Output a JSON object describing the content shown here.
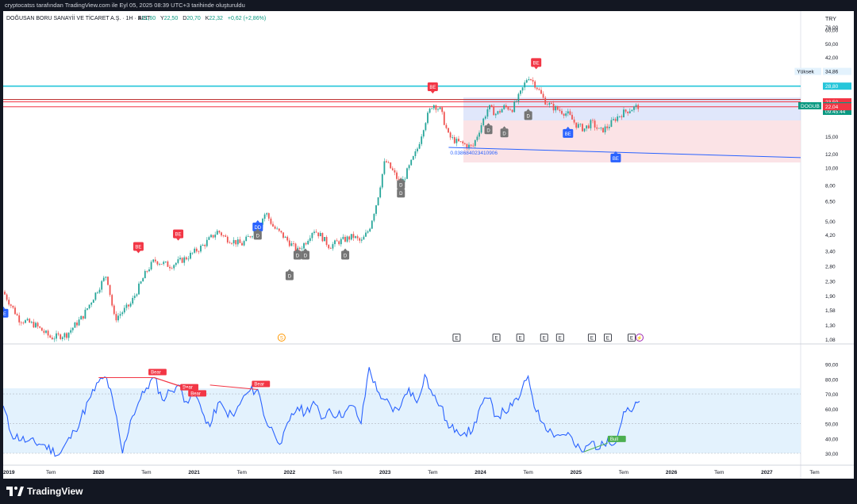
{
  "header": {
    "published_by": "cryptocatss tarafından TradingView.com ile Eyl 05, 2025 08:39 UTC+3 tarihinde oluşturuldu"
  },
  "legend": {
    "symbol": "DOĞUSAN BORU SANAYİİ VE TİCARET A.Ş. · 1H · BIST",
    "open_label": "A",
    "open": "21,60",
    "high_label": "Y",
    "high": "22,50",
    "low_label": "D",
    "low": "20,70",
    "close_label": "K",
    "close": "22,32",
    "change": "+0,62 (+2,86%)"
  },
  "currency": "TRY",
  "brand": "TradingView",
  "colors": {
    "up": "#26a69a",
    "down": "#ef5350",
    "rsi": "#2962ff",
    "bear": "#f23645",
    "bull": "#4caf50",
    "grey": "#757575"
  },
  "chart_data": [
    {
      "type": "candlestick",
      "y_scale": "log",
      "y_ticks": [
        "76,00",
        "60,00",
        "50,00",
        "42,00",
        "34,86",
        "28,80",
        "23,50",
        "22,32",
        "22,04",
        "15,00",
        "12,00",
        "10,00",
        "8,00",
        "6,50",
        "5,00",
        "4,20",
        "3,40",
        "2,80",
        "2,30",
        "1,90",
        "1,58",
        "1,30",
        "1,08"
      ],
      "x_ticks": [
        "2019",
        "Tem",
        "2020",
        "Tem",
        "2021",
        "Tem",
        "2022",
        "Tem",
        "2023",
        "Tem",
        "2024",
        "Tem",
        "2025",
        "Tem",
        "2026",
        "Tem",
        "2027",
        "Tem"
      ],
      "price_path": [
        [
          "2019-01",
          2.0
        ],
        [
          "2019-03",
          1.4
        ],
        [
          "2019-05",
          1.3
        ],
        [
          "2019-07",
          1.1
        ],
        [
          "2019-09",
          1.15
        ],
        [
          "2019-11",
          1.45
        ],
        [
          "2020-01",
          2.1
        ],
        [
          "2020-02",
          2.5
        ],
        [
          "2020-03",
          1.4
        ],
        [
          "2020-05",
          1.7
        ],
        [
          "2020-07",
          2.6
        ],
        [
          "2020-08",
          3.0
        ],
        [
          "2020-10",
          2.8
        ],
        [
          "2020-12",
          3.1
        ],
        [
          "2021-02",
          3.6
        ],
        [
          "2021-04",
          4.4
        ],
        [
          "2021-05",
          4.0
        ],
        [
          "2021-07",
          3.7
        ],
        [
          "2021-09",
          4.6
        ],
        [
          "2021-10",
          5.6
        ],
        [
          "2021-11",
          4.6
        ],
        [
          "2021-12",
          4.2
        ],
        [
          "2022-02",
          3.4
        ],
        [
          "2022-03",
          3.8
        ],
        [
          "2022-04",
          4.5
        ],
        [
          "2022-05",
          4.1
        ],
        [
          "2022-06",
          3.6
        ],
        [
          "2022-07",
          3.8
        ],
        [
          "2022-09",
          4.1
        ],
        [
          "2022-10",
          3.8
        ],
        [
          "2022-11",
          4.5
        ],
        [
          "2022-12",
          6.5
        ],
        [
          "2023-01",
          11.0
        ],
        [
          "2023-02",
          9.5
        ],
        [
          "2023-03",
          8.0
        ],
        [
          "2023-04",
          10.0
        ],
        [
          "2023-05",
          12.5
        ],
        [
          "2023-06",
          18.0
        ],
        [
          "2023-07",
          23.0
        ],
        [
          "2023-08",
          21.0
        ],
        [
          "2023-09",
          15.0
        ],
        [
          "2023-10",
          14.0
        ],
        [
          "2023-11",
          13.5
        ],
        [
          "2023-12",
          13.0
        ],
        [
          "2024-01",
          17.0
        ],
        [
          "2024-02",
          22.0
        ],
        [
          "2024-03",
          20.0
        ],
        [
          "2024-04",
          22.0
        ],
        [
          "2024-05",
          21.5
        ],
        [
          "2024-06",
          26.0
        ],
        [
          "2024-07",
          33.0
        ],
        [
          "2024-08",
          29.0
        ],
        [
          "2024-09",
          24.0
        ],
        [
          "2024-10",
          22.0
        ],
        [
          "2024-11",
          21.0
        ],
        [
          "2024-12",
          20.0
        ],
        [
          "2025-01",
          17.5
        ],
        [
          "2025-02",
          16.5
        ],
        [
          "2025-03",
          18.0
        ],
        [
          "2025-04",
          16.0
        ],
        [
          "2025-05",
          17.0
        ],
        [
          "2025-06",
          19.0
        ],
        [
          "2025-07",
          20.5
        ],
        [
          "2025-08",
          21.5
        ],
        [
          "2025-09",
          22.32
        ]
      ],
      "price_labels": [
        {
          "text": "Yüksek",
          "value": "34,86"
        },
        {
          "value": "28,80"
        },
        {
          "value": "23,50"
        },
        {
          "text": "DOGUB",
          "value": "22,32",
          "time": "09:45:44"
        },
        {
          "value": "22,04"
        }
      ],
      "trendline_label": "0.038684023410906",
      "horizontal_lines": [
        28.8,
        23.5,
        22.04
      ],
      "markers": [
        {
          "kind": "BE",
          "time": "2019-01",
          "price": 1.6,
          "color": "#2962ff"
        },
        {
          "kind": "BE",
          "time": "2020-06",
          "price": 3.4,
          "color": "#f23645"
        },
        {
          "kind": "BE",
          "time": "2020-11",
          "price": 4.0,
          "color": "#f23645"
        },
        {
          "kind": "BE",
          "time": "2023-07",
          "price": 27,
          "color": "#f23645"
        },
        {
          "kind": "BE",
          "time": "2024-08",
          "price": 37,
          "color": "#f23645"
        },
        {
          "kind": "BE",
          "time": "2024-12",
          "price": 16.5,
          "color": "#2962ff"
        },
        {
          "kind": "BE",
          "time": "2025-06",
          "price": 12.0,
          "color": "#2962ff"
        },
        {
          "kind": "DD",
          "time": "2021-09",
          "price": 4.9,
          "color": "#2962ff"
        },
        {
          "kind": "D",
          "time": "2021-09",
          "price": 4.4,
          "color": "#757575"
        },
        {
          "kind": "D",
          "time": "2022-01",
          "price": 2.6,
          "color": "#757575"
        },
        {
          "kind": "D",
          "time": "2022-02",
          "price": 3.4,
          "color": "#757575"
        },
        {
          "kind": "D",
          "time": "2022-03",
          "price": 3.4,
          "color": "#757575"
        },
        {
          "kind": "D",
          "time": "2022-08",
          "price": 3.4,
          "color": "#757575"
        },
        {
          "kind": "D",
          "time": "2023-03",
          "price": 7.6,
          "color": "#757575"
        },
        {
          "kind": "D",
          "time": "2023-03",
          "price": 8.5,
          "color": "#757575"
        },
        {
          "kind": "D",
          "time": "2024-02",
          "price": 17.3,
          "color": "#757575"
        },
        {
          "kind": "D",
          "time": "2024-04",
          "price": 16.6,
          "color": "#757575"
        },
        {
          "kind": "D",
          "time": "2024-07",
          "price": 20.8,
          "color": "#757575"
        }
      ],
      "events": [
        {
          "kind": "S",
          "time": "2021-12"
        },
        {
          "kind": "E",
          "time": "2023-10"
        },
        {
          "kind": "E",
          "time": "2024-03"
        },
        {
          "kind": "E",
          "time": "2024-06"
        },
        {
          "kind": "E",
          "time": "2024-09"
        },
        {
          "kind": "E",
          "time": "2024-11"
        },
        {
          "kind": "E",
          "time": "2025-03"
        },
        {
          "kind": "E",
          "time": "2025-05"
        },
        {
          "kind": "E",
          "time": "2025-08"
        },
        {
          "kind": "⚡",
          "time": "2025-09"
        }
      ]
    },
    {
      "type": "line",
      "y_ticks": [
        "90,00",
        "80,00",
        "70,00",
        "60,00",
        "50,00",
        "40,00",
        "30,00"
      ],
      "ylim": [
        27,
        95
      ],
      "band": [
        30,
        70
      ],
      "rsi_path": [
        [
          "2019-01",
          62
        ],
        [
          "2019-02",
          43
        ],
        [
          "2019-04",
          38
        ],
        [
          "2019-06",
          36
        ],
        [
          "2019-08",
          29
        ],
        [
          "2019-10",
          45
        ],
        [
          "2019-12",
          68
        ],
        [
          "2020-01",
          78
        ],
        [
          "2020-02",
          81
        ],
        [
          "2020-03",
          60
        ],
        [
          "2020-04",
          30
        ],
        [
          "2020-05",
          52
        ],
        [
          "2020-06",
          64
        ],
        [
          "2020-07",
          74
        ],
        [
          "2020-08",
          81
        ],
        [
          "2020-09",
          66
        ],
        [
          "2020-10",
          72
        ],
        [
          "2020-11",
          76
        ],
        [
          "2020-12",
          65
        ],
        [
          "2021-01",
          72
        ],
        [
          "2021-02",
          58
        ],
        [
          "2021-03",
          48
        ],
        [
          "2021-04",
          64
        ],
        [
          "2021-05",
          58
        ],
        [
          "2021-06",
          55
        ],
        [
          "2021-07",
          66
        ],
        [
          "2021-08",
          72
        ],
        [
          "2021-09",
          73
        ],
        [
          "2021-10",
          52
        ],
        [
          "2021-11",
          44
        ],
        [
          "2021-12",
          37
        ],
        [
          "2022-01",
          52
        ],
        [
          "2022-02",
          61
        ],
        [
          "2022-03",
          57
        ],
        [
          "2022-04",
          65
        ],
        [
          "2022-05",
          53
        ],
        [
          "2022-06",
          60
        ],
        [
          "2022-07",
          55
        ],
        [
          "2022-08",
          58
        ],
        [
          "2022-09",
          62
        ],
        [
          "2022-10",
          50
        ],
        [
          "2022-11",
          88
        ],
        [
          "2022-12",
          72
        ],
        [
          "2023-01",
          66
        ],
        [
          "2023-02",
          58
        ],
        [
          "2023-03",
          62
        ],
        [
          "2023-04",
          74
        ],
        [
          "2023-05",
          64
        ],
        [
          "2023-06",
          83
        ],
        [
          "2023-07",
          69
        ],
        [
          "2023-08",
          62
        ],
        [
          "2023-09",
          47
        ],
        [
          "2023-10",
          46
        ],
        [
          "2023-11",
          44
        ],
        [
          "2023-12",
          45
        ],
        [
          "2024-01",
          62
        ],
        [
          "2024-02",
          67
        ],
        [
          "2024-03",
          55
        ],
        [
          "2024-04",
          58
        ],
        [
          "2024-05",
          62
        ],
        [
          "2024-06",
          69
        ],
        [
          "2024-07",
          82
        ],
        [
          "2024-08",
          58
        ],
        [
          "2024-09",
          50
        ],
        [
          "2024-10",
          44
        ],
        [
          "2024-11",
          42
        ],
        [
          "2024-12",
          44
        ],
        [
          "2025-01",
          34
        ],
        [
          "2025-02",
          31
        ],
        [
          "2025-03",
          38
        ],
        [
          "2025-04",
          33
        ],
        [
          "2025-05",
          40
        ],
        [
          "2025-06",
          37
        ],
        [
          "2025-07",
          58
        ],
        [
          "2025-08",
          58
        ],
        [
          "2025-09",
          65
        ]
      ],
      "divergences": [
        {
          "label": "Bear",
          "from": [
            "2020-01",
            81
          ],
          "to": [
            "2020-08",
            81
          ],
          "color": "#f23645"
        },
        {
          "label": "Bear",
          "from": [
            "2020-08",
            81
          ],
          "to": [
            "2020-12",
            74
          ],
          "color": "#f23645"
        },
        {
          "label": "Bear",
          "from": [
            "2020-08",
            81
          ],
          "to": [
            "2021-01",
            72
          ],
          "color": "#f23645"
        },
        {
          "label": "Bear",
          "from": [
            "2021-03",
            76
          ],
          "to": [
            "2021-09",
            73
          ],
          "color": "#f23645"
        },
        {
          "label": "Bull",
          "from": [
            "2025-02",
            31
          ],
          "to": [
            "2025-05",
            37
          ],
          "color": "#4caf50"
        }
      ]
    }
  ]
}
